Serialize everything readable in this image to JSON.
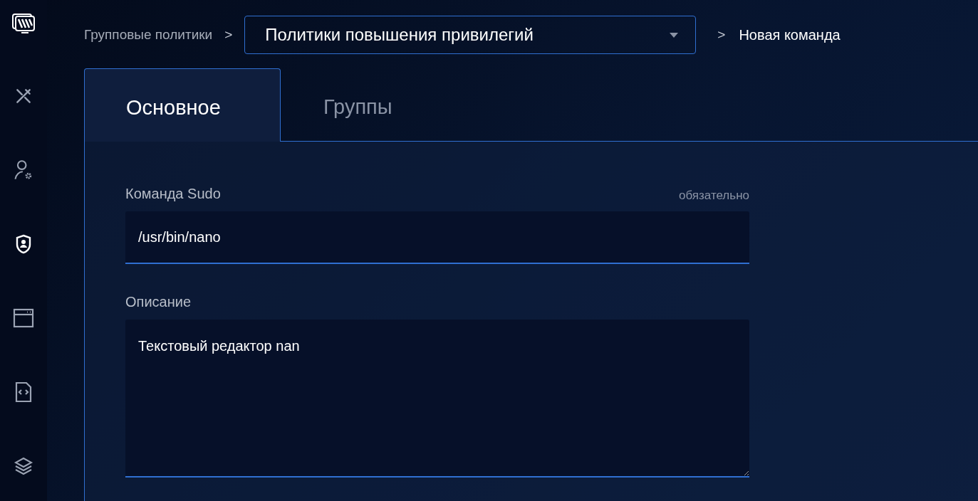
{
  "sidebar": {
    "items": [
      {
        "selected": false
      },
      {
        "selected": false
      },
      {
        "selected": true
      },
      {
        "selected": false
      },
      {
        "selected": false
      },
      {
        "selected": false
      }
    ]
  },
  "breadcrumb": {
    "root": "Групповые политики",
    "separator_1": ">",
    "dropdown": "Политики повышения привилегий",
    "separator_2": ">",
    "current": "Новая команда"
  },
  "tabs": [
    {
      "label": "Основное",
      "selected": true
    },
    {
      "label": "Группы",
      "selected": false
    }
  ],
  "form": {
    "fields": [
      {
        "kind": "input",
        "label": "Команда Sudo",
        "hint": "обязательно",
        "value": "/usr/bin/nano"
      },
      {
        "kind": "textarea",
        "label": "Описание",
        "value": "Текстовый редактор nan"
      }
    ]
  }
}
